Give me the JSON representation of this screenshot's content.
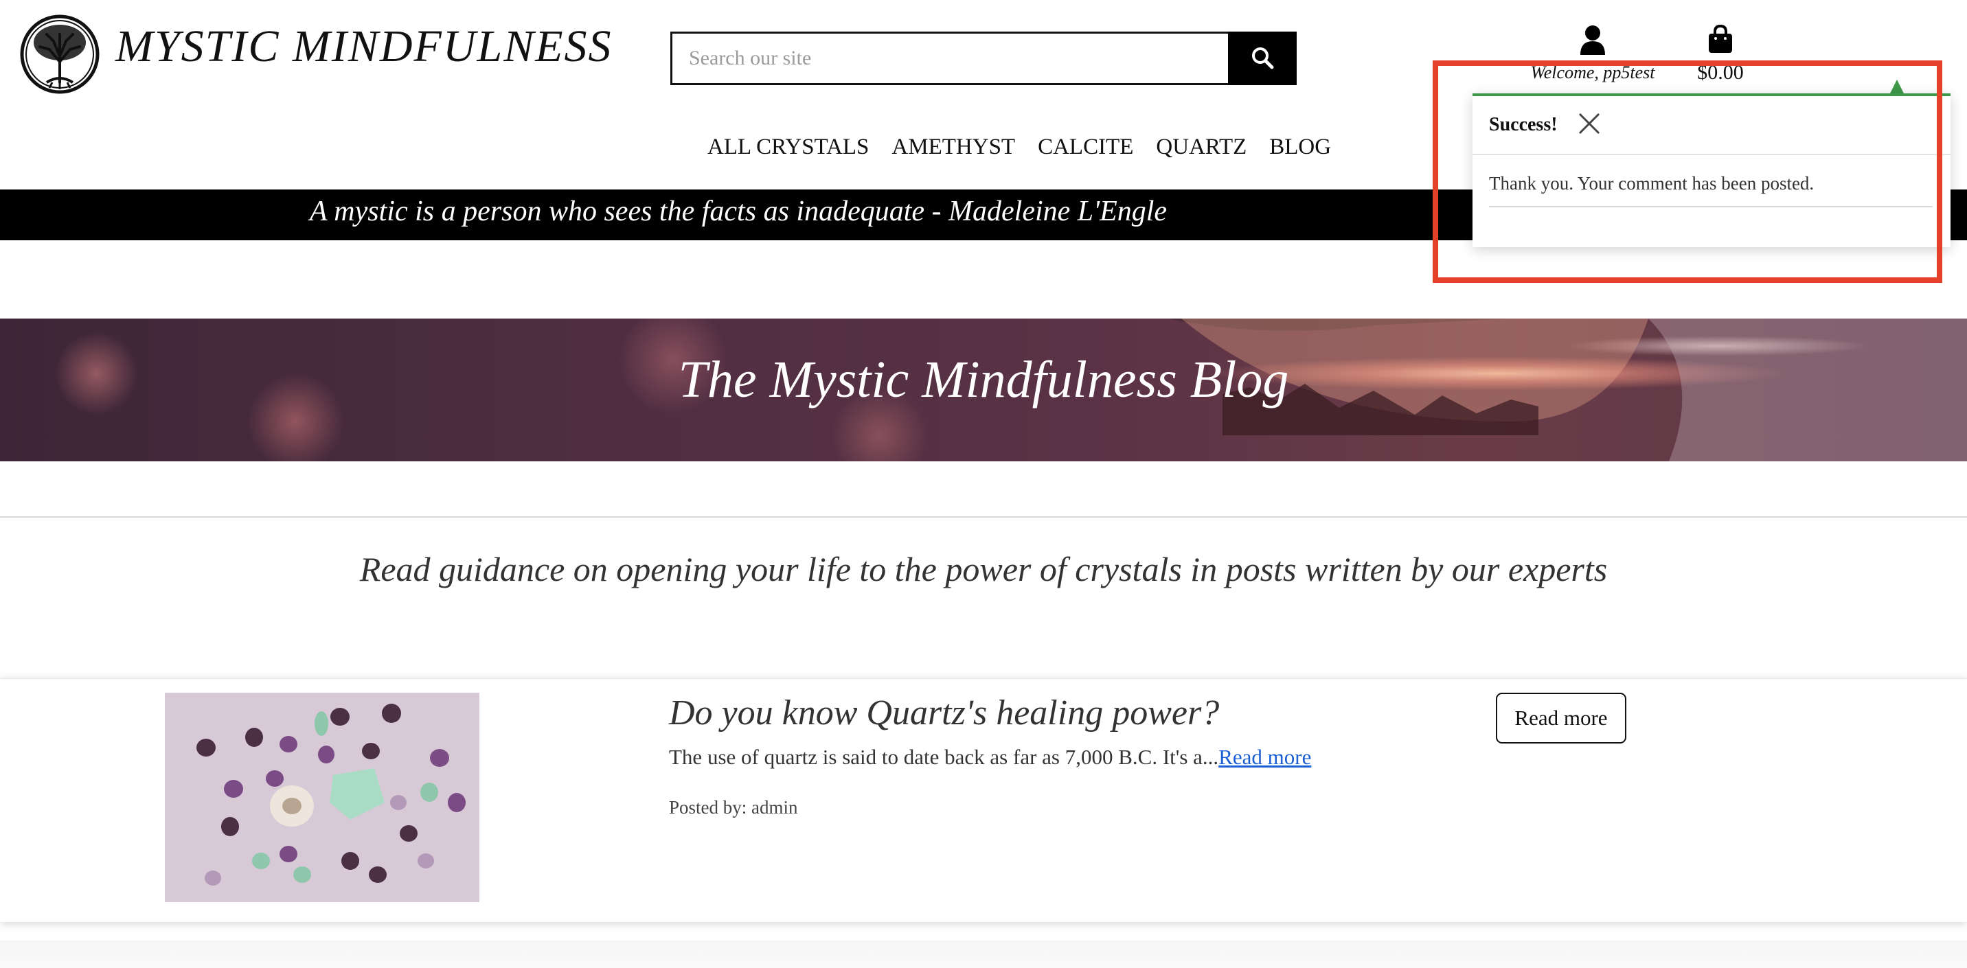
{
  "header": {
    "brand": "MYSTIC MINDFULNESS",
    "search_placeholder": "Search our site",
    "account_label": "Welcome, pp5test",
    "cart_total": "$0.00"
  },
  "nav": {
    "items": [
      "ALL CRYSTALS",
      "AMETHYST",
      "CALCITE",
      "QUARTZ",
      "BLOG"
    ]
  },
  "quote": "A mystic is a person who sees the facts as inadequate - Madeleine L'Engle",
  "hero": {
    "title": "The Mystic Mindfulness Blog"
  },
  "subtitle": "Read guidance on opening your life to the power of crystals in posts written by our experts",
  "posts": [
    {
      "title": "Do you know Quartz's healing power?",
      "excerpt": "The use of quartz is said to date back as far as 7,000 B.C. It's a...",
      "excerpt_link": "Read more",
      "author": "Posted by: admin",
      "button": "Read more"
    }
  ],
  "toast": {
    "title": "Success!",
    "message": "Thank you. Your comment has been posted."
  },
  "colors": {
    "success": "#3e9a49",
    "highlight": "#e4402a",
    "link": "#1a5fd6"
  },
  "icons": [
    "tree-of-life-logo-icon",
    "search-icon",
    "user-icon",
    "shopping-bag-icon",
    "close-icon"
  ]
}
